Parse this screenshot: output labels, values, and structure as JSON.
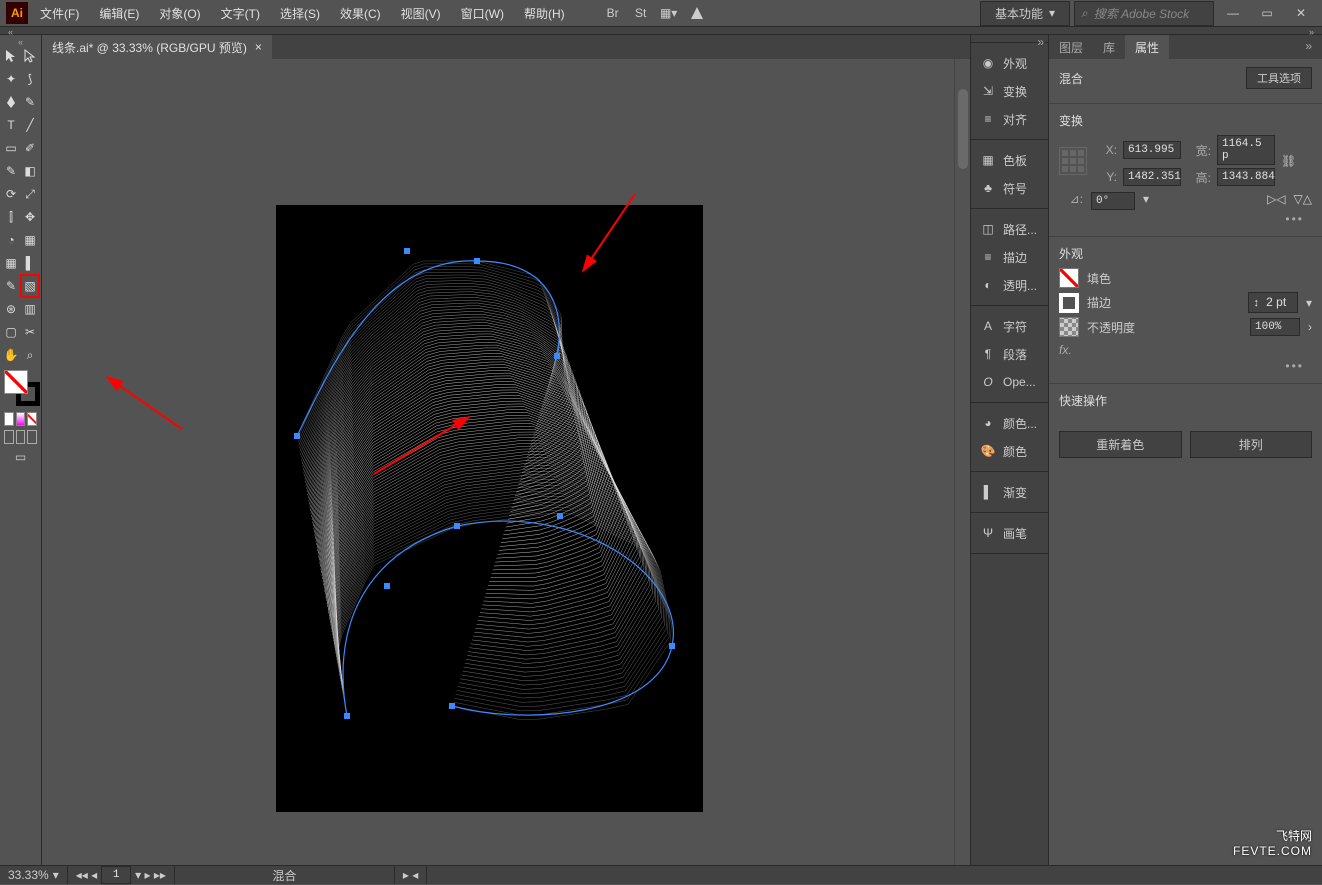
{
  "menu": {
    "file": "文件(F)",
    "edit": "编辑(E)",
    "object": "对象(O)",
    "type": "文字(T)",
    "select": "选择(S)",
    "effect": "效果(C)",
    "view": "视图(V)",
    "window": "窗口(W)",
    "help": "帮助(H)"
  },
  "workspace_label": "基本功能",
  "search_placeholder": "搜索 Adobe Stock",
  "doc_tab": "线条.ai* @ 33.33% (RGB/GPU 预览)",
  "status": {
    "zoom": "33.33%",
    "page": "1",
    "tool": "混合"
  },
  "dock": {
    "appearance": "外观",
    "transform": "变换",
    "align": "对齐",
    "swatches": "色板",
    "symbols": "符号",
    "pathfinder": "路径...",
    "stroke": "描边",
    "transparency": "透明...",
    "character": "字符",
    "paragraph": "段落",
    "opentype": "Ope...",
    "colorguide": "颜色...",
    "color": "颜色",
    "gradient": "渐变",
    "brushes": "画笔"
  },
  "prop_tabs": {
    "layers": "图层",
    "libs": "库",
    "properties": "属性"
  },
  "prop": {
    "selection": "混合",
    "tool_options": "工具选项",
    "transform_title": "变换",
    "x_label": "X:",
    "y_label": "Y:",
    "w_label": "宽:",
    "h_label": "高:",
    "x": "613.995",
    "y": "1482.351",
    "w": "1164.5 p",
    "h": "1343.884",
    "angle_label": "⊿:",
    "angle": "0°",
    "appearance_title": "外观",
    "fill": "填色",
    "stroke": "描边",
    "stroke_val": "2 pt",
    "opacity": "不透明度",
    "opacity_val": "100%",
    "fx": "fx.",
    "quick_title": "快速操作",
    "recolor": "重新着色",
    "arrange": "排列"
  },
  "watermark": {
    "line1": "飞特网",
    "line2": "FEVTE.COM"
  }
}
